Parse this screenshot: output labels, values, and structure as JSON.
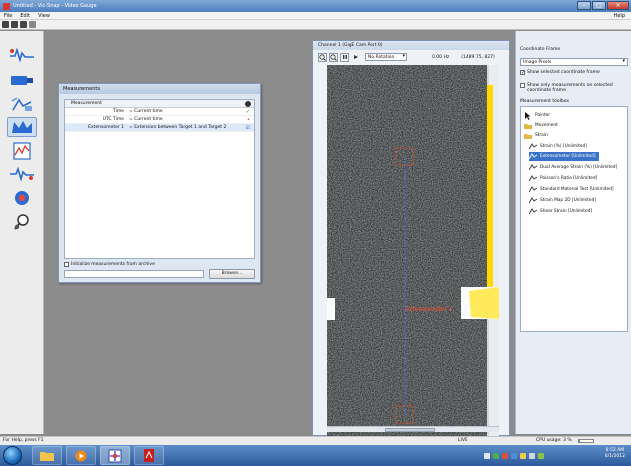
{
  "window": {
    "title": "Untitled - Vic-Snap - Video Gauge",
    "controls": {
      "minimize": "–",
      "maximize": "□",
      "close": "✕"
    }
  },
  "menu": {
    "items": [
      "File",
      "Edit",
      "View"
    ],
    "help": "Help"
  },
  "toolbar": {
    "icons": [
      "new-file-icon",
      "open-folder-icon",
      "save-icon",
      "export-icon"
    ]
  },
  "left_toolbar": {
    "icons": [
      "acquire-waveform-icon",
      "camera-setup-icon",
      "calibration-icon",
      "measurement-icon",
      "plot-icon",
      "data-flow-icon",
      "record-icon",
      "inspect-icon"
    ],
    "active_index": 3
  },
  "measurements_dialog": {
    "title": "Measurements",
    "header": "Measurement",
    "rows": [
      {
        "name": "Time",
        "value": "= Current time",
        "mark": "✓"
      },
      {
        "name": "UTC Time",
        "value": "= Current time",
        "mark": "•"
      },
      {
        "name": "Extensometer 1",
        "value": "= Extension between Target 1 and Target 2",
        "mark": "☑"
      }
    ],
    "init_label": "Initialize measurements from archive",
    "path_value": "",
    "browse_label": "Browse..."
  },
  "camera_window": {
    "title": "Channel 1 (GigE Cam Port 0)",
    "rotation": "No Rotation",
    "readout_hz": "0.00 Hz",
    "readout_coords": "(1489.75, 827)",
    "extensometer_label": "Extensometer 1"
  },
  "right_panel": {
    "coordinate_frame_label": "Coordinate Frame",
    "coordinate_frame_value": "Image Pixels",
    "show_selected_frame": {
      "label": "Show selected coordinate frame",
      "checked": true
    },
    "show_only_measurements": {
      "label": "Show only measurements on selected coordinate frame",
      "checked": false
    },
    "toolbox_label": "Measurement toolbox",
    "tools": [
      {
        "label": "Pointer",
        "icon": "pointer-icon",
        "indent": 0
      },
      {
        "label": "Movement",
        "icon": "folder-icon",
        "indent": 0
      },
      {
        "label": "Strain",
        "icon": "folder-icon",
        "indent": 0
      },
      {
        "label": "Strain (%) [Unlimited]",
        "icon": "strain-gauge-icon",
        "indent": 1
      },
      {
        "label": "Extensometer [Unlimited]",
        "icon": "strain-gauge-icon",
        "indent": 1,
        "highlighted": true
      },
      {
        "label": "Dual Average Strain (%) [Unlimited]",
        "icon": "strain-gauge-icon",
        "indent": 1
      },
      {
        "label": "Poisson's Ratio [Unlimited]",
        "icon": "strain-gauge-icon",
        "indent": 1
      },
      {
        "label": "Standard Material Test [Unlimited]",
        "icon": "strain-gauge-icon",
        "indent": 1
      },
      {
        "label": "Strain Map 2D [Unlimited]",
        "icon": "strain-gauge-icon",
        "indent": 1
      },
      {
        "label": "Shear Strain [Unlimited]",
        "icon": "strain-gauge-icon",
        "indent": 1
      }
    ]
  },
  "status_bar": {
    "help_text": "For Help, press F1",
    "mode": "LIVE",
    "cpu_label": "CPU usage: 3 %",
    "cpu_percent": 3
  },
  "taskbar": {
    "apps": [
      "explorer-icon",
      "media-player-icon",
      "video-gauge-icon",
      "pdf-icon"
    ],
    "time": "8:52 AM",
    "date": "6/1/2012"
  },
  "colors": {
    "accent": "#3a74c9",
    "extensometer": "#e0452f",
    "strain_bar": "#ffd800",
    "tracking_line": "#4a6cff"
  }
}
